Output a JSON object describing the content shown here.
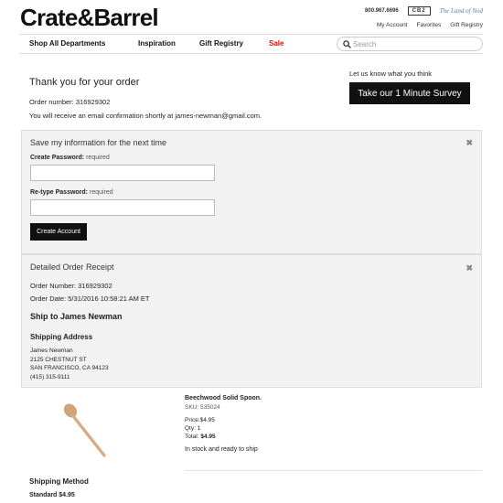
{
  "header": {
    "logo": "Crate&Barrel",
    "phone": "800.967.6696",
    "cb2": "CB2",
    "land_of_nod": "The Land of Nod",
    "account_links": [
      "My Account",
      "Favorites",
      "Gift Registry"
    ]
  },
  "nav": {
    "items": [
      "Shop All Departments",
      "Inspiration",
      "Gift Registry",
      "Sale"
    ],
    "search_placeholder": "Search"
  },
  "confirmation": {
    "title": "Thank you for your order",
    "order_number": "Order number: 316929302",
    "email_message": "You will receive an email confirmation shortly at james-newman@gmail.com.",
    "survey_prompt": "Let us know what you think",
    "survey_button": "Take our 1 Minute Survey"
  },
  "save_panel": {
    "title": "Save my information for the next time",
    "password_label": "Create Password:",
    "password_req": "required",
    "retype_label": "Re-type Password:",
    "retype_req": "required",
    "button": "Create Account"
  },
  "receipt": {
    "title": "Detailed Order Receipt",
    "order_number": "Order Number: 316929302",
    "order_date": "Order Date: 5/31/2016 10:58:21 AM ET",
    "ship_to": "Ship to James Newman",
    "shipping_address_title": "Shipping Address",
    "address_lines": [
      "James Newman",
      "2125 CHESTNUT ST",
      "SAN FRANCISCO, CA 94123",
      "(415) 315-9111"
    ]
  },
  "product": {
    "name": "Beechwood Solid Spoon.",
    "sku": "SKU: 535024",
    "price": "Price:$4.95",
    "qty": "Qty: 1",
    "total_label": "Total:",
    "total_value": "$4.95",
    "stock": "In stock and ready to ship"
  },
  "shipping": {
    "title": "Shipping Method",
    "standard": "Standard $4.95"
  },
  "colors": {
    "sale": "#dd1111",
    "button_bg": "#111111",
    "panel_bg": "#f2f2f2"
  }
}
